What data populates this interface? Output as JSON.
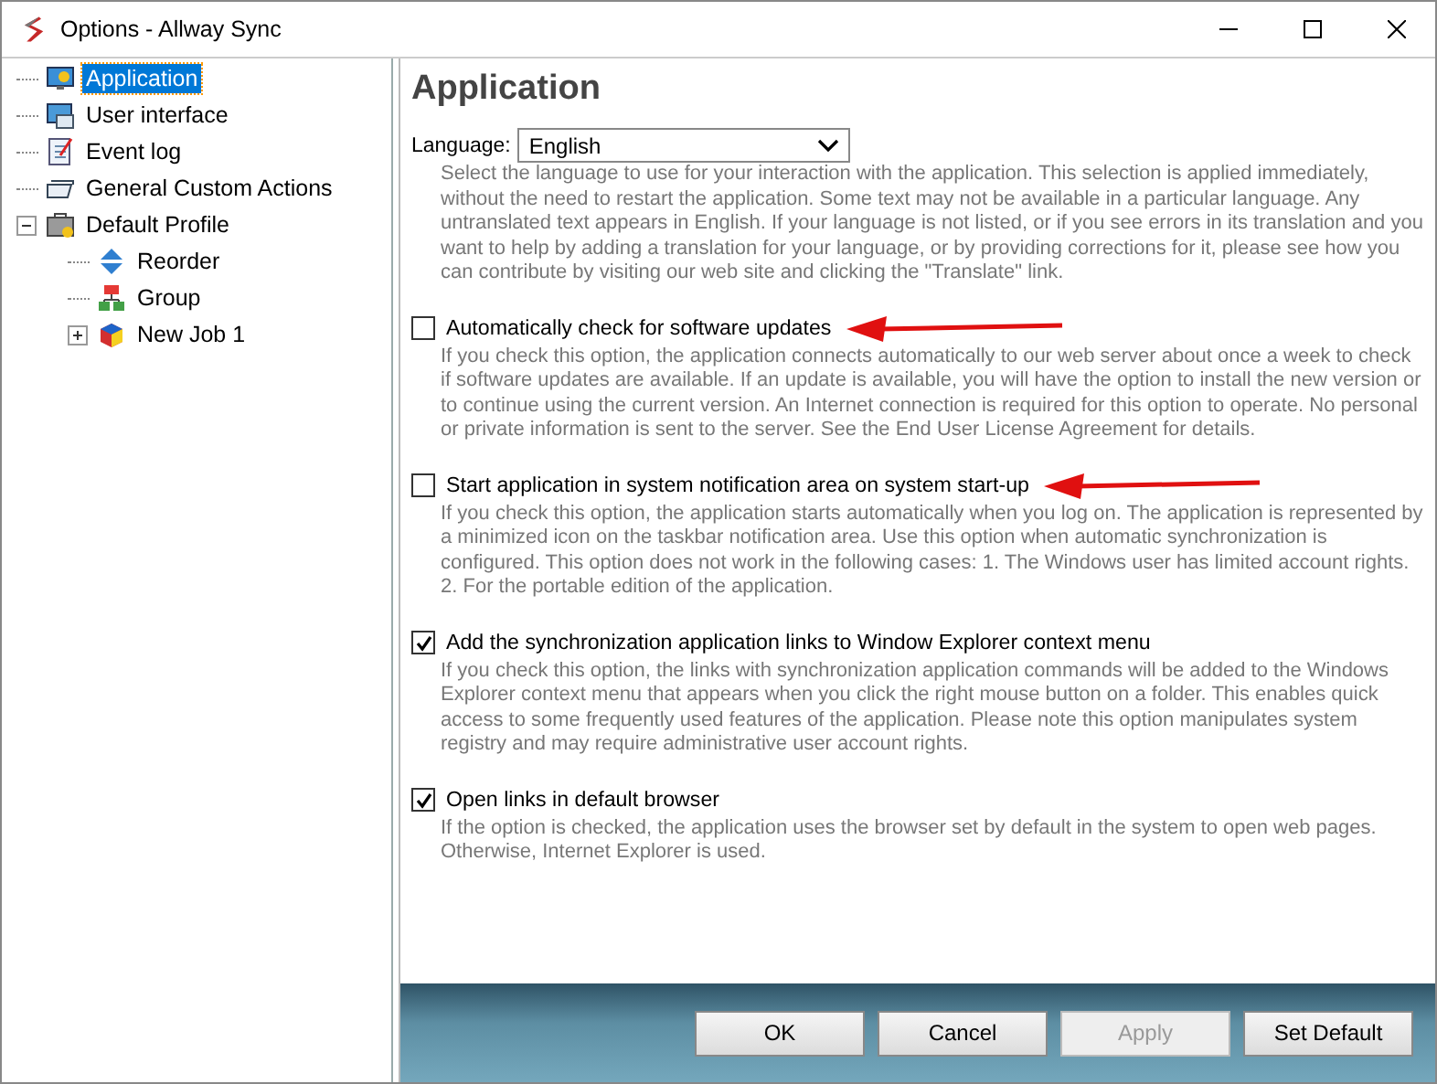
{
  "window": {
    "title": "Options - Allway Sync"
  },
  "tree": [
    {
      "label": "Application",
      "kind": "application",
      "selected": true
    },
    {
      "label": "User interface",
      "kind": "ui",
      "selected": false
    },
    {
      "label": "Event log",
      "kind": "log",
      "selected": false
    },
    {
      "label": "General Custom Actions",
      "kind": "actions",
      "selected": false
    },
    {
      "label": "Default Profile",
      "kind": "profile",
      "selected": false,
      "expanded": true,
      "children": [
        {
          "label": "Reorder",
          "kind": "reorder",
          "selected": false
        },
        {
          "label": "Group",
          "kind": "group",
          "selected": false
        },
        {
          "label": "New Job 1",
          "kind": "job",
          "selected": false,
          "expanded": false
        }
      ]
    }
  ],
  "page": {
    "heading": "Application",
    "language": {
      "label": "Language:",
      "value": "English",
      "description": "Select the language to use for your interaction with the application. This selection is applied immediately, without the need to restart the application. Some text may not be available in a particular language. Any untranslated text appears in English. If your language is not listed, or if you see errors in its translation and you want to help by adding a translation for your language, or by providing corrections for it, please see how you can contribute by visiting our web site and clicking the \"Translate\" link."
    },
    "options": [
      {
        "label": "Automatically check for software updates",
        "checked": false,
        "arrow": true,
        "description": "If you check this option, the application connects automatically to our web server about once a week to check if software updates are available. If an update is available, you will have the option to install the new version or to continue using the current version. An Internet connection is required for this option to operate. No personal or private information is sent to the server. See the End User License Agreement for details."
      },
      {
        "label": "Start application in system notification area on system start-up",
        "checked": false,
        "arrow": true,
        "description": "If you check this option, the application starts automatically when you log on. The application is represented by a minimized icon on the taskbar notification area. Use this option when automatic synchronization is configured. This option does not work in the following cases: 1. The Windows user has limited account rights. 2. For the portable edition of the application."
      },
      {
        "label": "Add the synchronization application links to Window Explorer context menu",
        "checked": true,
        "arrow": false,
        "description": "If you check this option, the links with synchronization application commands will be added to the Windows Explorer context menu that appears when you click the right mouse button on a folder. This enables quick access to some frequently used features of the application. Please note this option manipulates system registry and may require administrative user account rights."
      },
      {
        "label": "Open links in default browser",
        "checked": true,
        "arrow": false,
        "description": "If the option is checked, the application uses the browser set by default in the system to open web pages. Otherwise, Internet Explorer is used."
      }
    ]
  },
  "buttons": [
    {
      "label": "OK",
      "disabled": false
    },
    {
      "label": "Cancel",
      "disabled": false
    },
    {
      "label": "Apply",
      "disabled": true
    },
    {
      "label": "Set Default",
      "disabled": false
    }
  ]
}
